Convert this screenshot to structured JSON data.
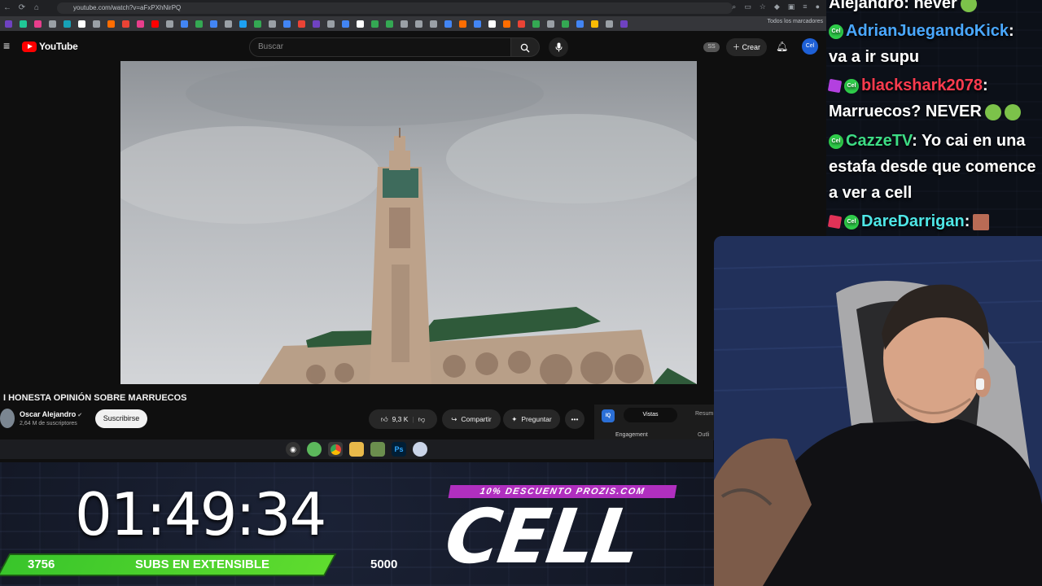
{
  "browser": {
    "url": "youtube.com/watch?v=aFxPXhNirPQ",
    "bookmarks_folder": "Todos los marcadores",
    "bookmark_colors": [
      "#6f42c1",
      "#20c997",
      "#e83e8c",
      "#9aa0a6",
      "#17a2b8",
      "#ffffff",
      "#9aa0a6",
      "#ff6d00",
      "#ea4335",
      "#e83e8c",
      "#ff0000",
      "#9aa0a6",
      "#4285f4",
      "#34a853",
      "#4285f4",
      "#9aa0a6",
      "#1da1f2",
      "#34a853",
      "#9aa0a6",
      "#4285f4",
      "#ea4335",
      "#6f42c1",
      "#9aa0a6",
      "#4285f4",
      "#ffffff",
      "#34a853",
      "#34a853",
      "#9aa0a6",
      "#9aa0a6",
      "#9aa0a6",
      "#4285f4",
      "#ff6d00",
      "#4285f4",
      "#ffffff",
      "#ff6d00",
      "#ea4335",
      "#34a853",
      "#9aa0a6",
      "#34a853",
      "#4285f4",
      "#fbbc04",
      "#9aa0a6",
      "#6f42c1"
    ]
  },
  "youtube": {
    "logo_text": "YouTube",
    "search_placeholder": "Buscar",
    "ss_badge": "SS",
    "create_label": "Crear",
    "avatar_text": "Cel",
    "video_title": "I HONESTA OPINIÓN SOBRE MARRUECOS",
    "channel_name": "Oscar Alejandro",
    "channel_subs": "2,64 M de suscriptores",
    "subscribe_label": "Suscribirse",
    "likes": "9,3 K",
    "share_label": "Compartir",
    "ask_label": "Preguntar",
    "side_panel": {
      "logo": "IQ",
      "tab_active": "Vistas",
      "tab_other": "Resum",
      "section_left": "Engagement",
      "section_right": "Outli"
    }
  },
  "taskbar": {
    "icons": [
      "obs-icon",
      "green-app-icon",
      "chrome-icon",
      "folder-icon",
      "game-icon",
      "photoshop-icon",
      "bird-icon"
    ]
  },
  "overlay": {
    "timer": "01:49:34",
    "subs_current": "3756",
    "subs_label": "SUBS EN EXTENSIBLE",
    "subs_goal": "5000",
    "promo": "10% DESCUENTO PROZIS.COM",
    "logo": "CELL",
    "accent_green": "#3fcf2c",
    "promo_purple": "#b02fbf"
  },
  "chat": [
    {
      "user": "Alejandro",
      "user_color": "#ffffff",
      "message": ": never",
      "badges": [],
      "emote": "sick"
    },
    {
      "user": "AdrianJuegandoKick",
      "user_color": "#4aa8ff",
      "message": ":",
      "badges": [
        "ce"
      ]
    },
    {
      "user": "",
      "user_color": "#ffffff",
      "message": "va a ir supu",
      "badges": []
    },
    {
      "user": "blackshark2078",
      "user_color": "#ff3b4e",
      "message": ":",
      "badges": [
        "cube",
        "ce"
      ]
    },
    {
      "user": "",
      "user_color": "#ffffff",
      "message": "Marruecos? NEVER",
      "badges": [],
      "emote": "sick2"
    },
    {
      "user": "CazzeTV",
      "user_color": "#3ddc84",
      "message": ": Yo cai en una",
      "badges": [
        "ce"
      ]
    },
    {
      "user": "",
      "user_color": "#ffffff",
      "message": "estafa desde que comence",
      "badges": []
    },
    {
      "user": "",
      "user_color": "#ffffff",
      "message": "a ver a cell",
      "badges": []
    },
    {
      "user": "DareDarrigan",
      "user_color": "#4ee6e6",
      "message": ":",
      "badges": [
        "cube-red",
        "ce"
      ],
      "emote": "box"
    }
  ]
}
